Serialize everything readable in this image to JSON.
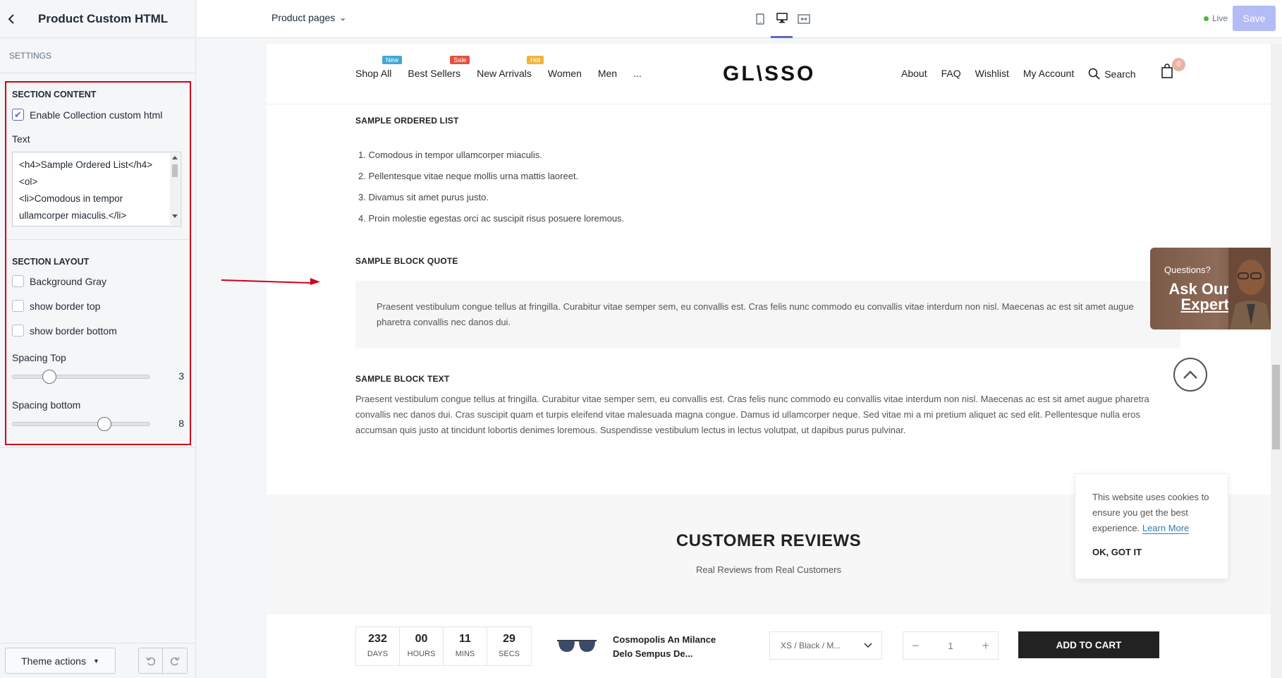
{
  "sidebar": {
    "title": "Product Custom HTML",
    "settings_label": "SETTINGS",
    "section_content_title": "SECTION CONTENT",
    "enable_label": "Enable Collection custom html",
    "text_label": "Text",
    "textarea_lines": [
      "<h4>Sample Ordered List</h4>",
      "<ol>",
      "<li>Comodous in tempor",
      "ullamcorper miaculis.</li>"
    ],
    "section_layout_title": "SECTION LAYOUT",
    "bg_gray_label": "Background Gray",
    "border_top_label": "show border top",
    "border_bottom_label": "show border bottom",
    "spacing_top_label": "Spacing Top",
    "spacing_top_value": "3",
    "spacing_bottom_label": "Spacing bottom",
    "spacing_bottom_value": "8",
    "theme_actions_label": "Theme actions"
  },
  "topbar": {
    "page_select": "Product pages",
    "live_label": "Live",
    "save_label": "Save"
  },
  "site": {
    "nav_left": [
      "Shop All",
      "Best Sellers",
      "New Arrivals",
      "Women",
      "Men",
      "..."
    ],
    "badges": {
      "new": "New",
      "sale": "Sale",
      "hot": "Hot"
    },
    "logo": "GL\\SSO",
    "nav_right": [
      "About",
      "FAQ",
      "Wishlist",
      "My Account"
    ],
    "search_label": "Search",
    "cart_count": "0",
    "ol_title": "SAMPLE ORDERED LIST",
    "ol_items": [
      "1. Comodous in tempor ullamcorper miaculis.",
      "2. Pellentesque vitae neque mollis urna mattis laoreet.",
      "3. Divamus sit amet purus justo.",
      "4. Proin molestie egestas orci ac suscipit risus posuere loremous."
    ],
    "quote_title": "SAMPLE BLOCK QUOTE",
    "quote_text": "Praesent vestibulum congue tellus at fringilla. Curabitur vitae semper sem, eu convallis est. Cras felis nunc commodo eu convallis vitae interdum non nisl. Maecenas ac est sit amet augue pharetra convallis nec danos dui.",
    "block_title": "SAMPLE BLOCK TEXT",
    "block_text": "Praesent vestibulum congue tellus at fringilla. Curabitur vitae semper sem, eu convallis est. Cras felis nunc commodo eu convallis vitae interdum non nisl. Maecenas ac est sit amet augue pharetra convallis nec danos dui. Cras suscipit quam et turpis eleifend vitae malesuada magna congue. Damus id ullamcorper neque. Sed vitae mi a mi pretium aliquet ac sed elit. Pellentesque nulla eros accumsan quis justo at tincidunt lobortis denimes loremous. Suspendisse vestibulum lectus in lectus volutpat, ut dapibus purus pulvinar.",
    "expert_question": "Questions?",
    "expert_line1": "Ask Our",
    "expert_line2": "Expert",
    "reviews_title": "CUSTOMER REVIEWS",
    "reviews_sub": "Real Reviews from Real Customers",
    "cookie_text": "This website uses cookies to ensure you get the best experience.",
    "cookie_learn": "Learn More",
    "cookie_ok": "OK, GOT IT",
    "countdown": [
      {
        "num": "232",
        "label": "DAYS"
      },
      {
        "num": "00",
        "label": "HOURS"
      },
      {
        "num": "11",
        "label": "MINS"
      },
      {
        "num": "29",
        "label": "SECS"
      }
    ],
    "product_name": "Cosmopolis An Milance Delo Sempus De...",
    "variant": "XS / Black / M...",
    "qty": "1",
    "add_to_cart": "ADD TO CART"
  },
  "colors": {
    "accent": "#5c6ac4",
    "highlight_border": "#d0021b",
    "badge_new": "#3fa9d6",
    "badge_sale": "#e2523b",
    "badge_hot": "#f0b43c"
  }
}
